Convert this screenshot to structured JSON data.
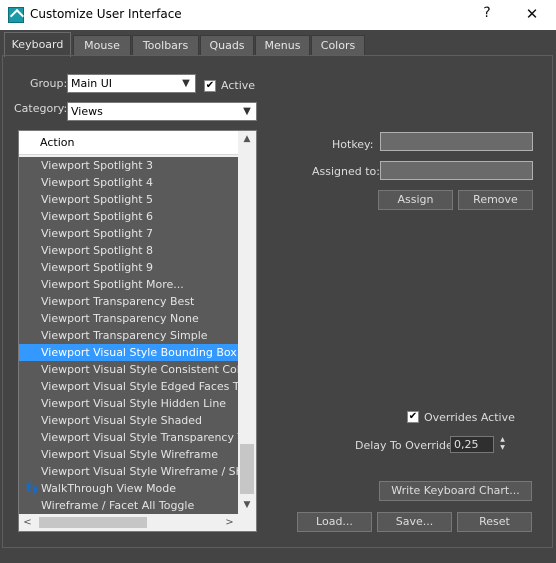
{
  "window": {
    "title": "Customize User Interface",
    "help_label": "?",
    "close_label": "✕"
  },
  "tabs": [
    {
      "label": "Keyboard",
      "active": true
    },
    {
      "label": "Mouse"
    },
    {
      "label": "Toolbars"
    },
    {
      "label": "Quads"
    },
    {
      "label": "Menus"
    },
    {
      "label": "Colors"
    }
  ],
  "group": {
    "label": "Group:",
    "value": "Main UI"
  },
  "active": {
    "label": "Active",
    "checked": true
  },
  "category": {
    "label": "Category:",
    "value": "Views"
  },
  "action_list": {
    "header": "Action",
    "items": [
      "Viewport Spotlight 3",
      "Viewport Spotlight 4",
      "Viewport Spotlight 5",
      "Viewport Spotlight 6",
      "Viewport Spotlight 7",
      "Viewport Spotlight 8",
      "Viewport Spotlight 9",
      "Viewport Spotlight More...",
      "Viewport Transparency Best",
      "Viewport Transparency None",
      "Viewport Transparency Simple",
      "Viewport Visual Style Bounding Box",
      "Viewport Visual Style Consistent Colors",
      "Viewport Visual Style Edged Faces Toggle",
      "Viewport Visual Style Hidden Line",
      "Viewport Visual Style Shaded",
      "Viewport Visual Style Transparency Toggle",
      "Viewport Visual Style Wireframe",
      "Viewport Visual Style Wireframe / Shaded",
      "WalkThrough View Mode",
      "Wireframe / Facet All Toggle"
    ],
    "selected_index": 11,
    "icon_item_index": 19,
    "icon_name": "footsteps-icon"
  },
  "hotkey": {
    "label": "Hotkey:",
    "value": ""
  },
  "assigned_to": {
    "label": "Assigned to:",
    "value": ""
  },
  "buttons": {
    "assign": "Assign",
    "remove": "Remove",
    "write_chart": "Write Keyboard Chart...",
    "load": "Load...",
    "save": "Save...",
    "reset": "Reset"
  },
  "overrides": {
    "label": "Overrides Active",
    "checked": true
  },
  "delay": {
    "label": "Delay To Override:",
    "value": "0,25"
  },
  "colors": {
    "background": "#444444",
    "selection": "#3399ff",
    "list_bg": "#5a5a5a"
  }
}
